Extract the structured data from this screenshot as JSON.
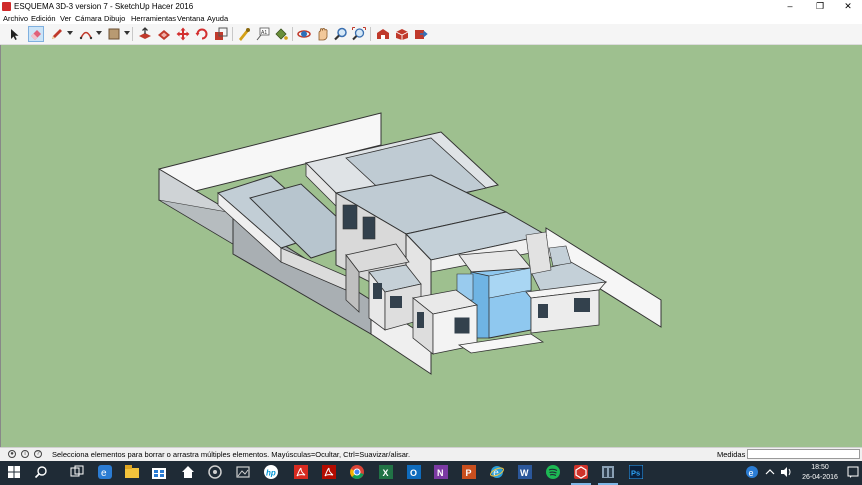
{
  "window": {
    "title": "ESQUEMA 3D-3 version 7 - SketchUp Hacer 2016",
    "controls": [
      "–",
      "❐",
      "✕"
    ]
  },
  "menu": [
    "Archivo",
    "Edición",
    "Ver",
    "Cámara",
    "Dibujo",
    "Herramientas",
    "Ventana",
    "Ayuda"
  ],
  "toolbar": {
    "tools": [
      {
        "name": "select-tool-icon",
        "color": "#222222"
      },
      {
        "name": "eraser-tool-icon",
        "color": "#e0607a"
      },
      {
        "name": "pencil-line-tool-icon",
        "color": "#c0392b"
      },
      {
        "name": "arc-tool-icon",
        "color": "#c0392b"
      },
      {
        "name": "shape-tool-icon",
        "color": "#8a6d4a"
      },
      {
        "name": "push-pull-tool-icon",
        "color": "#c0392b"
      },
      {
        "name": "offset-tool-icon",
        "color": "#c0392b"
      },
      {
        "name": "move-tool-icon",
        "color": "#d32f2f"
      },
      {
        "name": "rotate-tool-icon",
        "color": "#d32f2f"
      },
      {
        "name": "scale-tool-icon",
        "color": "#c0392b"
      },
      {
        "name": "tape-measure-tool-icon",
        "color": "#d4a017"
      },
      {
        "name": "text-tool-icon",
        "color": "#555555"
      },
      {
        "name": "paint-bucket-tool-icon",
        "color": "#6a8f3a"
      },
      {
        "name": "orbit-tool-icon",
        "color": "#2c6fbb"
      },
      {
        "name": "pan-tool-icon",
        "color": "#e0a060"
      },
      {
        "name": "zoom-tool-icon",
        "color": "#3a6fb0"
      },
      {
        "name": "zoom-extents-tool-icon",
        "color": "#3a6fb0"
      },
      {
        "name": "warehouse-icon",
        "color": "#c0392b"
      },
      {
        "name": "extension-warehouse-icon",
        "color": "#c0392b"
      },
      {
        "name": "layout-send-icon",
        "color": "#c0392b"
      }
    ]
  },
  "status": {
    "message": "Selecciona elementos para borrar o arrastra múltiples elementos. Mayúsculas=Ocultar, Ctrl=Suavizar/alisar.",
    "measure_label": "Medidas",
    "measure_value": ""
  },
  "taskbar": {
    "time": "18:50",
    "date": "26-04-2016",
    "apps": [
      {
        "name": "start-icon",
        "color": "#ffffff"
      },
      {
        "name": "search-icon",
        "color": "#ffffff"
      },
      {
        "name": "task-view-icon",
        "color": "#ffffff"
      },
      {
        "name": "edge-icon",
        "color": "#2b7cd3"
      },
      {
        "name": "file-explorer-icon",
        "color": "#f3c33c"
      },
      {
        "name": "store-icon",
        "color": "#2b7cd3"
      },
      {
        "name": "home-icon",
        "color": "#ffffff"
      },
      {
        "name": "media-icon",
        "color": "#cfcfcf"
      },
      {
        "name": "hp-icon",
        "color": "#0096d6"
      },
      {
        "name": "acrobat-icon",
        "color": "#d82a20"
      },
      {
        "name": "acrobat-dc-icon",
        "color": "#d82a20"
      },
      {
        "name": "chrome-icon",
        "color": "#e8b532"
      },
      {
        "name": "excel-icon",
        "color": "#217346"
      },
      {
        "name": "outlook-icon",
        "color": "#0f6cbd"
      },
      {
        "name": "onenote-icon",
        "color": "#7b3aa3"
      },
      {
        "name": "powerpoint-icon",
        "color": "#c94f1e"
      },
      {
        "name": "internet-explorer-icon",
        "color": "#2b9fd9"
      },
      {
        "name": "word-icon",
        "color": "#2b579a"
      },
      {
        "name": "spotify-icon",
        "color": "#1db954"
      },
      {
        "name": "sketchup-icon",
        "color": "#d0322a"
      },
      {
        "name": "app-window-icon",
        "color": "#8aa0b4"
      },
      {
        "name": "photoshop-icon",
        "color": "#2fa3f7"
      }
    ]
  }
}
